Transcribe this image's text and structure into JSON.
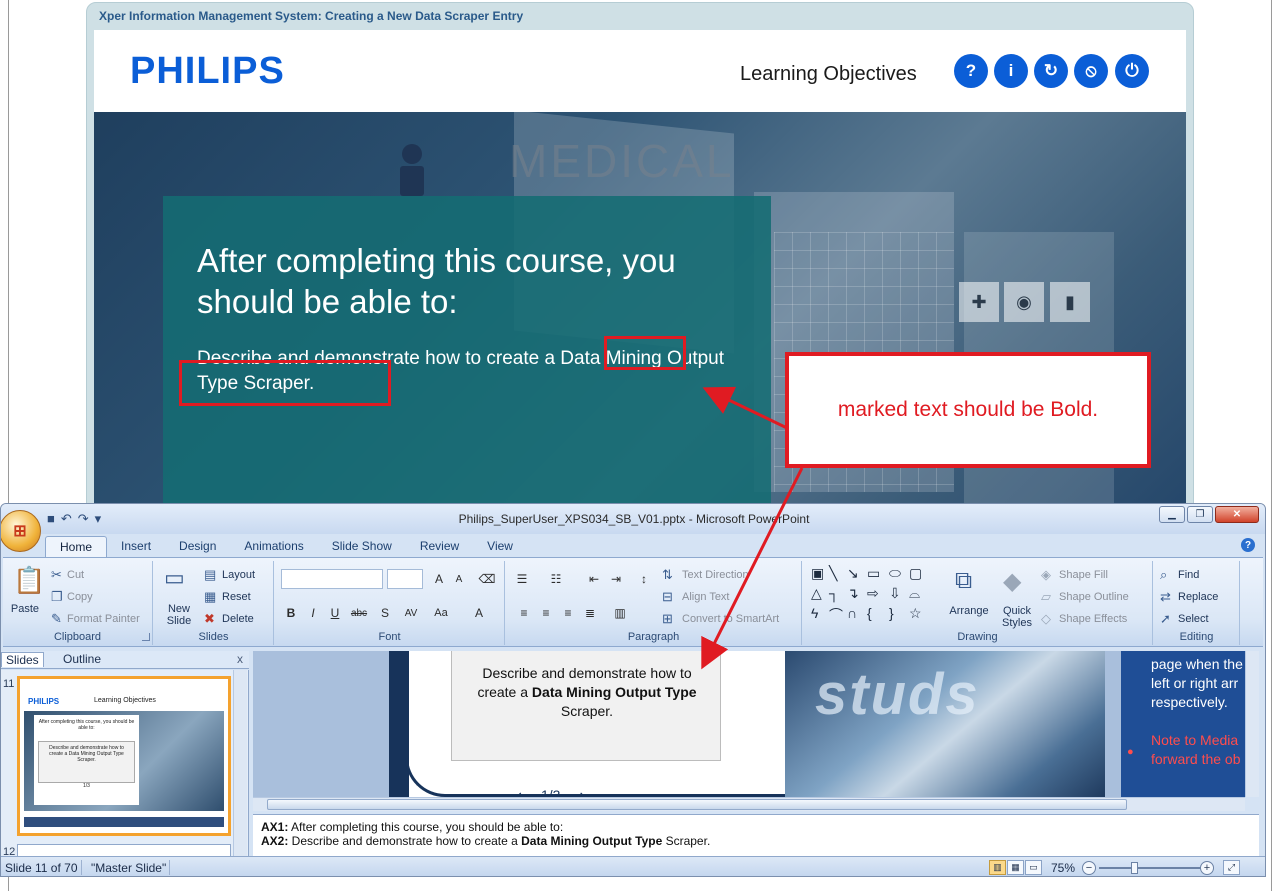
{
  "course": {
    "window_title": "Xper Information Management System: Creating a New Data Scraper Entry",
    "logo": "PHILIPS",
    "section_title": "Learning Objectives",
    "nav_buttons": [
      {
        "icon": "help-icon",
        "glyph": "?"
      },
      {
        "icon": "info-icon",
        "glyph": "i"
      },
      {
        "icon": "reset-icon",
        "glyph": "↻"
      },
      {
        "icon": "compass-icon",
        "glyph": "⦸"
      },
      {
        "icon": "power-icon",
        "glyph": "⏻"
      }
    ],
    "heading": "After completing this course, you should be able to:",
    "objective": "Describe and demonstrate how to create a Data Mining Output Type Scraper.",
    "watermark_text": "MEDICAL"
  },
  "annotation": {
    "callout_text": "marked text should be Bold.",
    "color": "#e01b22"
  },
  "powerpoint": {
    "title": "Philips_SuperUser_XPS034_SB_V01.pptx - Microsoft PowerPoint",
    "tabs": [
      "Home",
      "Insert",
      "Design",
      "Animations",
      "Slide Show",
      "Review",
      "View"
    ],
    "active_tab": "Home",
    "ribbon": {
      "clipboard": {
        "label": "Clipboard",
        "paste": "Paste",
        "cut": "Cut",
        "copy": "Copy",
        "format_painter": "Format Painter"
      },
      "slides": {
        "label": "Slides",
        "new_slide": "New Slide",
        "layout": "Layout",
        "reset": "Reset",
        "delete": "Delete"
      },
      "font": {
        "label": "Font",
        "font_name": "",
        "font_size": ""
      },
      "paragraph": {
        "label": "Paragraph",
        "text_direction": "Text Direction",
        "align_text": "Align Text",
        "convert_smartart": "Convert to SmartArt"
      },
      "drawing": {
        "label": "Drawing",
        "arrange": "Arrange",
        "quick_styles": "Quick Styles",
        "shape_fill": "Shape Fill",
        "shape_outline": "Shape Outline",
        "shape_effects": "Shape Effects"
      },
      "editing": {
        "label": "Editing",
        "find": "Find",
        "replace": "Replace",
        "select": "Select"
      }
    },
    "pane_tabs": {
      "slides": "Slides",
      "outline": "Outline",
      "close": "x"
    },
    "thumbnail": {
      "number": "11",
      "next_number": "12",
      "logo": "PHILIPS",
      "title": "Learning Objectives",
      "heading": "After completing this course, you should be able to:",
      "body": "Describe and demonstrate how to create a Data Mining Output Type Scraper.",
      "nav": "1/3"
    },
    "slide_card": {
      "line1": "Describe and demonstrate how to",
      "prefix": "create a ",
      "bold": "Data Mining Output Type",
      "suffix": "Scraper.",
      "nav": "1/3"
    },
    "slide_photo_text": "studs",
    "side_notes": {
      "lines": [
        "page when the",
        "left or right arr",
        "respectively."
      ],
      "red_lines": [
        "Note to Media",
        "forward the ob"
      ]
    },
    "notes": {
      "ax1_label": "AX1:",
      "ax1_text": " After completing this course, you should be able to:",
      "ax2_label": "AX2:",
      "ax2_text_pre": " Describe and demonstrate how to create a ",
      "ax2_bold": "Data Mining Output Type",
      "ax2_text_post": " Scraper."
    },
    "status": {
      "slide_info": "Slide 11 of 70",
      "theme": "\"Master Slide\"",
      "zoom": "75%"
    }
  }
}
